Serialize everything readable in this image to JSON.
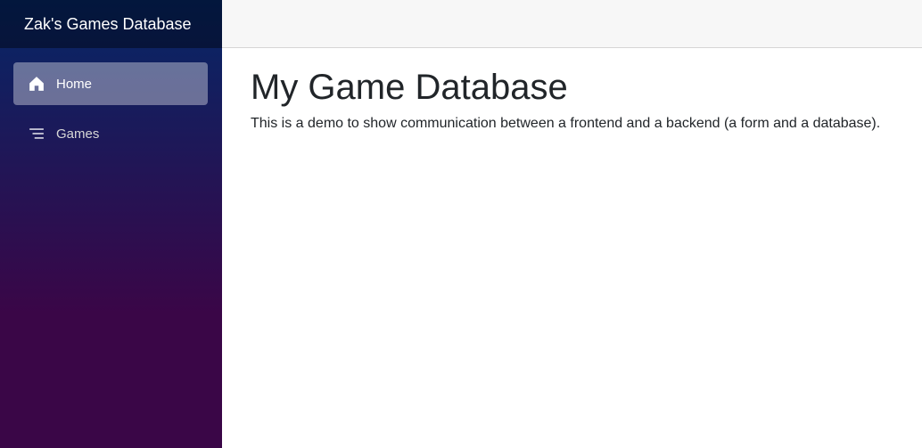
{
  "sidebar": {
    "brand": "Zak's Games Database",
    "items": [
      {
        "label": "Home",
        "icon": "home-icon",
        "active": true
      },
      {
        "label": "Games",
        "icon": "list-icon",
        "active": false
      }
    ]
  },
  "main": {
    "title": "My Game Database",
    "description": "This is a demo to show communication between a frontend and a backend (a form and a database)."
  },
  "colors": {
    "sidebar_top": "#052767",
    "sidebar_bottom": "#3a0647",
    "top_row": "#f7f7f7"
  }
}
